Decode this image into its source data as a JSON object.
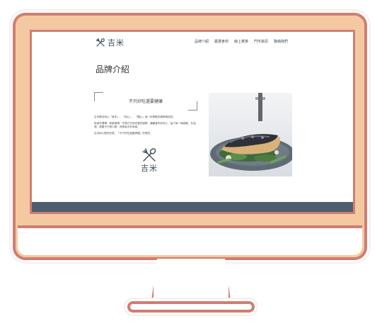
{
  "site": {
    "logo_text": "吉米",
    "nav": [
      "品牌介紹",
      "嚴選食材",
      "線上菜單",
      "門市資訊",
      "聯絡我們"
    ],
    "page_title": "品牌介紹",
    "quote": "不只好吃還要健康",
    "paragraphs": [
      "吉米堅持用心「食安」、「用心」、「關心」每一份餐點的細節與品質。",
      "從食材選擇、新鮮處理、烹調方式到完整的服務，讓顧客吃到安心，留下每一個感動。在這裡，健康不只是口號，而是每天的承諾。",
      "吉米用心堅持初衷，「不只好吃還要健康」的理念。"
    ],
    "brand_mark_text": "吉米"
  },
  "colors": {
    "bezel": "#f4c9a2",
    "outline": "#cf7e73",
    "footer_band": "#4d5f6e",
    "logo": "#3c4b58"
  },
  "icons": {
    "logo": "fork-and-spoon-icon",
    "brand_mark": "fork-and-spoon-icon",
    "photo": "salad-plate-photo"
  }
}
